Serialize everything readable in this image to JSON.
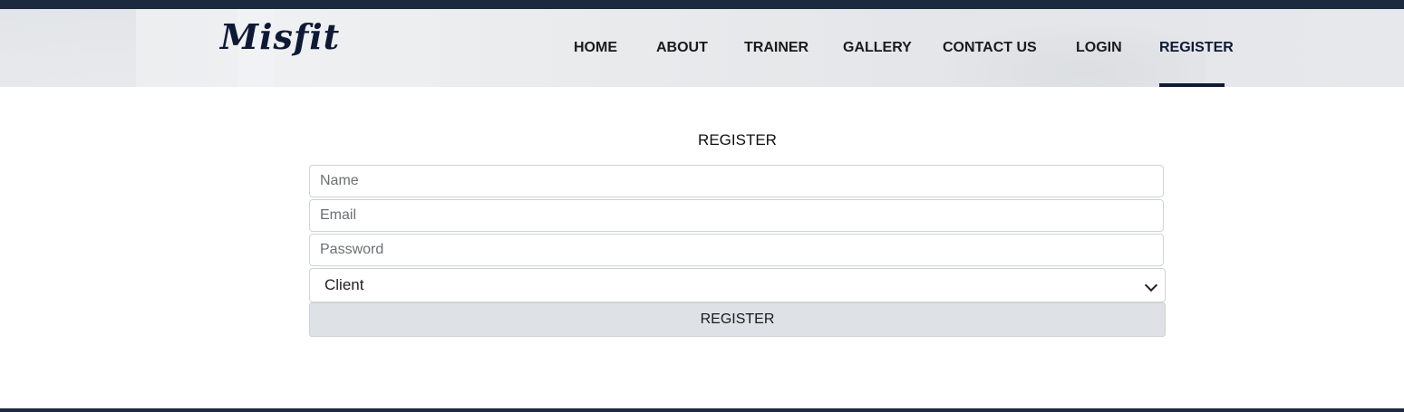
{
  "brand": {
    "logo_text": "Misfit"
  },
  "nav": {
    "items": [
      {
        "label": "HOME"
      },
      {
        "label": "ABOUT"
      },
      {
        "label": "TRAINER"
      },
      {
        "label": "GALLERY"
      },
      {
        "label": "CONTACT US"
      },
      {
        "label": "LOGIN"
      },
      {
        "label": "REGISTER",
        "active": true
      }
    ]
  },
  "form": {
    "title": "REGISTER",
    "name_placeholder": "Name",
    "email_placeholder": "Email",
    "password_placeholder": "Password",
    "role_selected": "Client",
    "submit_label": "REGISTER"
  },
  "colors": {
    "brand_navy": "#0e1a35",
    "button_bg": "#dee1e5"
  }
}
